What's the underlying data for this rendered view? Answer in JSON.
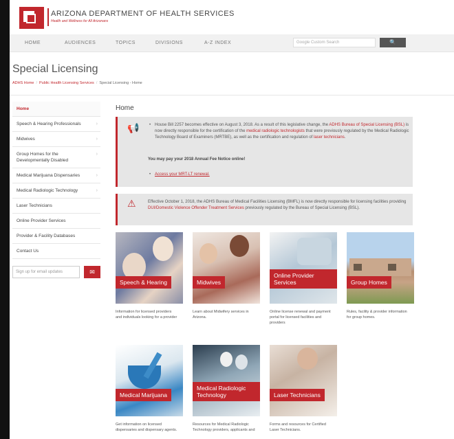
{
  "header": {
    "title": "ARIZONA DEPARTMENT OF HEALTH SERVICES",
    "tagline": "Health and Wellness for All Arizonans"
  },
  "nav": {
    "items": [
      "HOME",
      "AUDIENCES",
      "TOPICS",
      "DIVISIONS",
      "A-Z INDEX"
    ],
    "search_placeholder": "Google Custom Search",
    "search_button": "🔍"
  },
  "page": {
    "title": "Special Licensing",
    "breadcrumb": [
      "ADHS Home",
      "Public Health Licensing Services",
      "Special Licensing - Home"
    ]
  },
  "sidebar": {
    "items": [
      {
        "label": "Home",
        "chevron": ""
      },
      {
        "label": "Speech & Hearing Professionals",
        "chevron": "›"
      },
      {
        "label": "Midwives",
        "chevron": "›"
      },
      {
        "label": "Group Homes for the Developmentally Disabled",
        "chevron": "›"
      },
      {
        "label": "Medical Marijuana Dispensaries",
        "chevron": "›"
      },
      {
        "label": "Medical Radiologic Technology",
        "chevron": "›"
      },
      {
        "label": "Laser Technicians",
        "chevron": ""
      },
      {
        "label": "Online Provider Services",
        "chevron": ""
      },
      {
        "label": "Provider & Facility Databases",
        "chevron": ""
      },
      {
        "label": "Contact Us",
        "chevron": ""
      }
    ],
    "email_placeholder": "Sign up for email updates",
    "email_button": "✉"
  },
  "main": {
    "heading": "Home",
    "alert1": {
      "icon": "📢",
      "b1_part1": "House Bill 2257 becomes effective on August 3, 2018. As a result of this legislative change, the ",
      "b1_link1": "ADHS Bureau of Special Licensing (BSL)",
      "b1_part2": " is now directly responsible for the certification of the ",
      "b1_link2": "medical radiologic technologists",
      "b1_part3": " that were previously regulated by the Medical Radiologic Technology Board of Examiners (MRTBE), as well as the certification and regulation of ",
      "b1_link3": "laser technicians",
      "b1_part4": ".",
      "notice": "You may pay your 2018 Annual Fee Notice online!",
      "b2_link": "Access your MRT-LT renewal."
    },
    "alert2": {
      "icon": "⚠",
      "part1": "Effective October 1, 2018, the ADHS Bureau of Medical Facilities Licensing (BMFL) is now directly responsible for licensing facilities providing ",
      "link": "DUI/Domestic Violence Offender Treatment Services",
      "part2": " previously regulated by the Bureau of Special Licensing (BSL)."
    },
    "cards": [
      {
        "label": "Speech & Hearing",
        "desc": "Information for licensed providers and individuals looking for a provider"
      },
      {
        "label": "Midwives",
        "desc": "Learn about Midwifery services in Arizona."
      },
      {
        "label": "Online Provider Services",
        "desc": "Online license renewal and payment portal for licensed facilities and providers"
      },
      {
        "label": "Group Homes",
        "desc": "Rules, facility & provider information for group homes."
      },
      {
        "label": "Medical Marijuana",
        "desc": "Get information on licensed dispensaries and dispensary agents."
      },
      {
        "label": "Medical Radiologic Technology",
        "desc": "Resources for Medical Radiologic Technology providers, applicants and"
      },
      {
        "label": "Laser Technicians",
        "desc": "Forms and resources for Certified Laser Technicians."
      }
    ]
  }
}
